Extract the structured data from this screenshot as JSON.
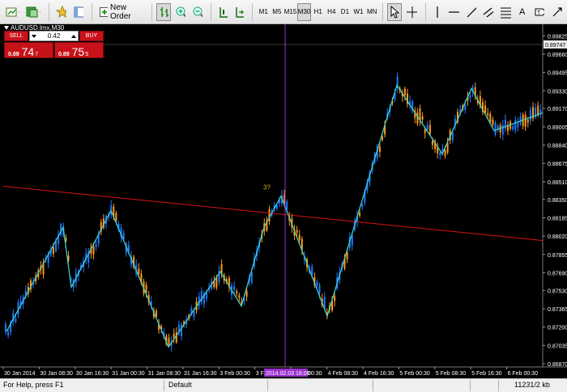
{
  "toolbar": {
    "new_order_label": "New Order",
    "timeframes": [
      "M1",
      "M5",
      "M15",
      "M30",
      "H1",
      "H4",
      "D1",
      "W1",
      "MN"
    ],
    "active_timeframe": "M30",
    "text_tool_label": "A"
  },
  "chart": {
    "symbol": "AUDUSD.lmx,M30",
    "wave_label": "3?",
    "current_price_label": "0.89747",
    "cursor_time_label": "2014.02.03 18:00",
    "colors": {
      "background": "#000000",
      "bull_candle": "#1e7bff",
      "bear_candle": "#ff9a1a",
      "zigzag": "#3fd8cc",
      "trendline": "#d81414",
      "crosshair": "#9b30d0",
      "axis_text": "#ffffff"
    }
  },
  "trade_panel": {
    "sell_label": "SELL",
    "buy_label": "BUY",
    "lot_value": "0.42",
    "sell_price_small": "0.89",
    "sell_price_big": "74",
    "sell_price_sup": "7",
    "buy_price_small": "0.89",
    "buy_price_big": "75",
    "buy_price_sup": "5"
  },
  "price_axis": [
    "0.89825",
    "0.89660",
    "0.89495",
    "0.89330",
    "0.89170",
    "0.89005",
    "0.88840",
    "0.88675",
    "0.88510",
    "0.88350",
    "0.88185",
    "0.88020",
    "0.87855",
    "0.87690",
    "0.87530",
    "0.87365",
    "0.87200",
    "0.87035",
    "0.86870"
  ],
  "time_axis": [
    "30 Jan 2014",
    "30 Jan 08:30",
    "30 Jan 16:30",
    "31 Jan 00:30",
    "31 Jan 08:30",
    "31 Jan 16:30",
    "3 Feb 00:30",
    "3 Feb 08:30",
    "4 Feb 00:30",
    "4 Feb 08:30",
    "4 Feb 16:30",
    "5 Feb 00:30",
    "5 Feb 08:30",
    "5 Feb 16:30",
    "6 Feb 00:30"
  ],
  "statusbar": {
    "help_text": "For Help, press F1",
    "profile": "Default",
    "traffic": "11231/2 kb"
  },
  "chart_data": {
    "type": "candlestick",
    "symbol": "AUDUSD",
    "timeframe": "M30",
    "ylim": [
      0.8687,
      0.899
    ],
    "zigzag_points": [
      {
        "time": "30 Jan 2014 00:30",
        "price": 0.8716
      },
      {
        "time": "30 Jan 2014 06:00",
        "price": 0.881
      },
      {
        "time": "30 Jan 2014 10:30",
        "price": 0.8756
      },
      {
        "time": "30 Jan 2014 23:30",
        "price": 0.8825
      },
      {
        "time": "31 Jan 2014 12:00",
        "price": 0.8702
      },
      {
        "time": "31 Jan 2014 19:30",
        "price": 0.877
      },
      {
        "time": "3 Feb 2014 00:00",
        "price": 0.8739
      },
      {
        "time": "3 Feb 2014 08:00",
        "price": 0.881
      },
      {
        "time": "3 Feb 2014 18:00",
        "price": 0.8838
      },
      {
        "time": "4 Feb 2014 03:30",
        "price": 0.873
      },
      {
        "time": "4 Feb 2014 21:30",
        "price": 0.8938
      },
      {
        "time": "5 Feb 2014 11:00",
        "price": 0.8876
      },
      {
        "time": "5 Feb 2014 18:30",
        "price": 0.8935
      },
      {
        "time": "6 Feb 2014 00:30",
        "price": 0.8897
      },
      {
        "time": "6 Feb 2014 05:00",
        "price": 0.8913
      }
    ],
    "trendline": [
      {
        "time": "30 Jan 2014 00:00",
        "price": 0.8847
      },
      {
        "time": "6 Feb 2014 05:30",
        "price": 0.8798
      }
    ],
    "last_price": 0.89747
  }
}
